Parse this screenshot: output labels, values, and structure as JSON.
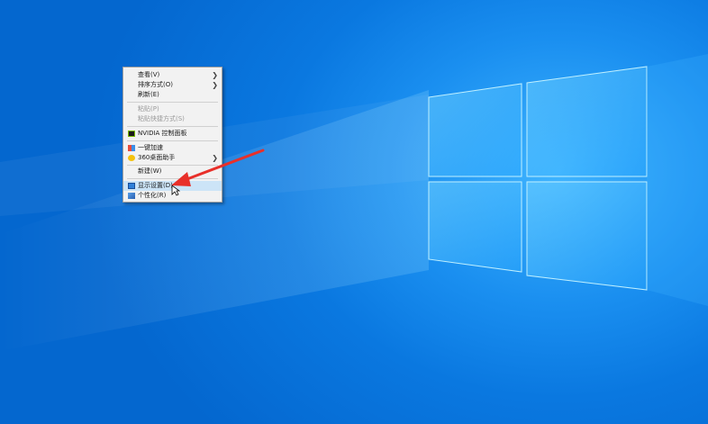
{
  "desktop": {
    "background_accent": "#0a78e0"
  },
  "context_menu": {
    "items": [
      {
        "label": "查看(V)",
        "submenu": true
      },
      {
        "label": "排序方式(O)",
        "submenu": true
      },
      {
        "label": "刷新(E)"
      },
      {
        "label": "粘贴(P)",
        "disabled": true
      },
      {
        "label": "粘贴快捷方式(S)",
        "disabled": true
      },
      {
        "label": "NVIDIA 控制面板",
        "icon": "nvidia-icon"
      },
      {
        "label": "一键加速",
        "icon": "speed-boost-icon"
      },
      {
        "label": "360桌面助手",
        "icon": "360-desktop-icon",
        "submenu": true
      },
      {
        "label": "新建(W)",
        "submenu": true
      },
      {
        "label": "显示设置(D)",
        "icon": "display-settings-icon",
        "highlighted": true
      },
      {
        "label": "个性化(R)",
        "icon": "personalize-icon"
      }
    ]
  },
  "annotation": {
    "color": "#e8302a",
    "icon": "red-arrow-annotation"
  }
}
